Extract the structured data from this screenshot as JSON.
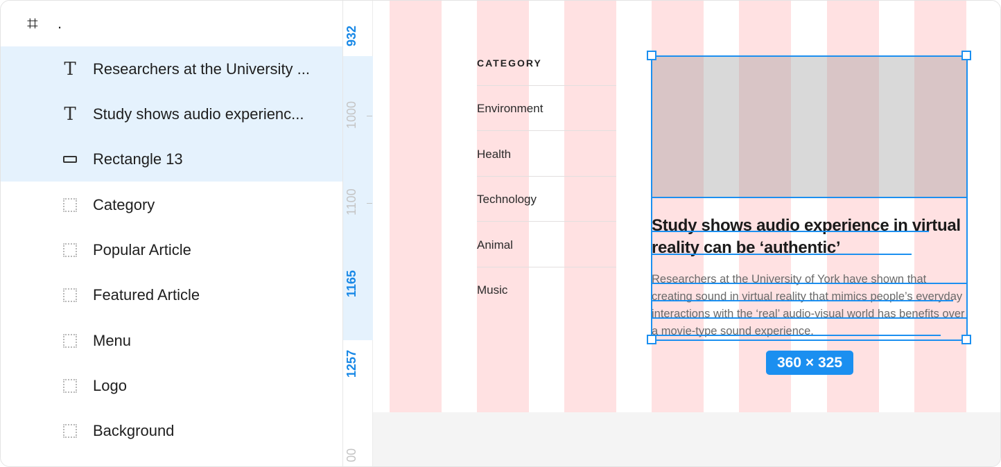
{
  "layers": {
    "frame": {
      "label": "."
    },
    "items": [
      {
        "type": "text",
        "label": "Researchers at the University ...",
        "selected": true
      },
      {
        "type": "text",
        "label": "Study shows audio experienc...",
        "selected": true
      },
      {
        "type": "rectangle",
        "label": "Rectangle 13",
        "selected": true
      },
      {
        "type": "group",
        "label": "Category",
        "selected": false
      },
      {
        "type": "group",
        "label": "Popular Article",
        "selected": false
      },
      {
        "type": "group",
        "label": "Featured Article",
        "selected": false
      },
      {
        "type": "group",
        "label": "Menu",
        "selected": false
      },
      {
        "type": "group",
        "label": "Logo",
        "selected": false
      },
      {
        "type": "group",
        "label": "Background",
        "selected": false
      }
    ]
  },
  "ruler": {
    "labels": [
      "932",
      "1000",
      "1100",
      "1165",
      "1257",
      "00"
    ],
    "highlighted": [
      "932",
      "1165",
      "1257"
    ]
  },
  "canvas": {
    "category": {
      "heading": "CATEGORY",
      "items": [
        "Environment",
        "Health",
        "Technology",
        "Animal",
        "Music"
      ]
    },
    "article": {
      "headline": "Study shows audio experience in virtual reality can be ‘authentic’",
      "body": "Researchers at the University of York have shown that creating sound in virtual reality that mimics people’s everyday interactions with the ‘real’ audio-visual world has benefits over a movie-type sound experience."
    },
    "selection": {
      "dimensions": "360 × 325"
    }
  },
  "colors": {
    "selection": "#1b8ff0",
    "layer_highlight": "#e5f2fd",
    "grid_column": "#ffe1e2",
    "image_placeholder": "#d9d9d9"
  }
}
